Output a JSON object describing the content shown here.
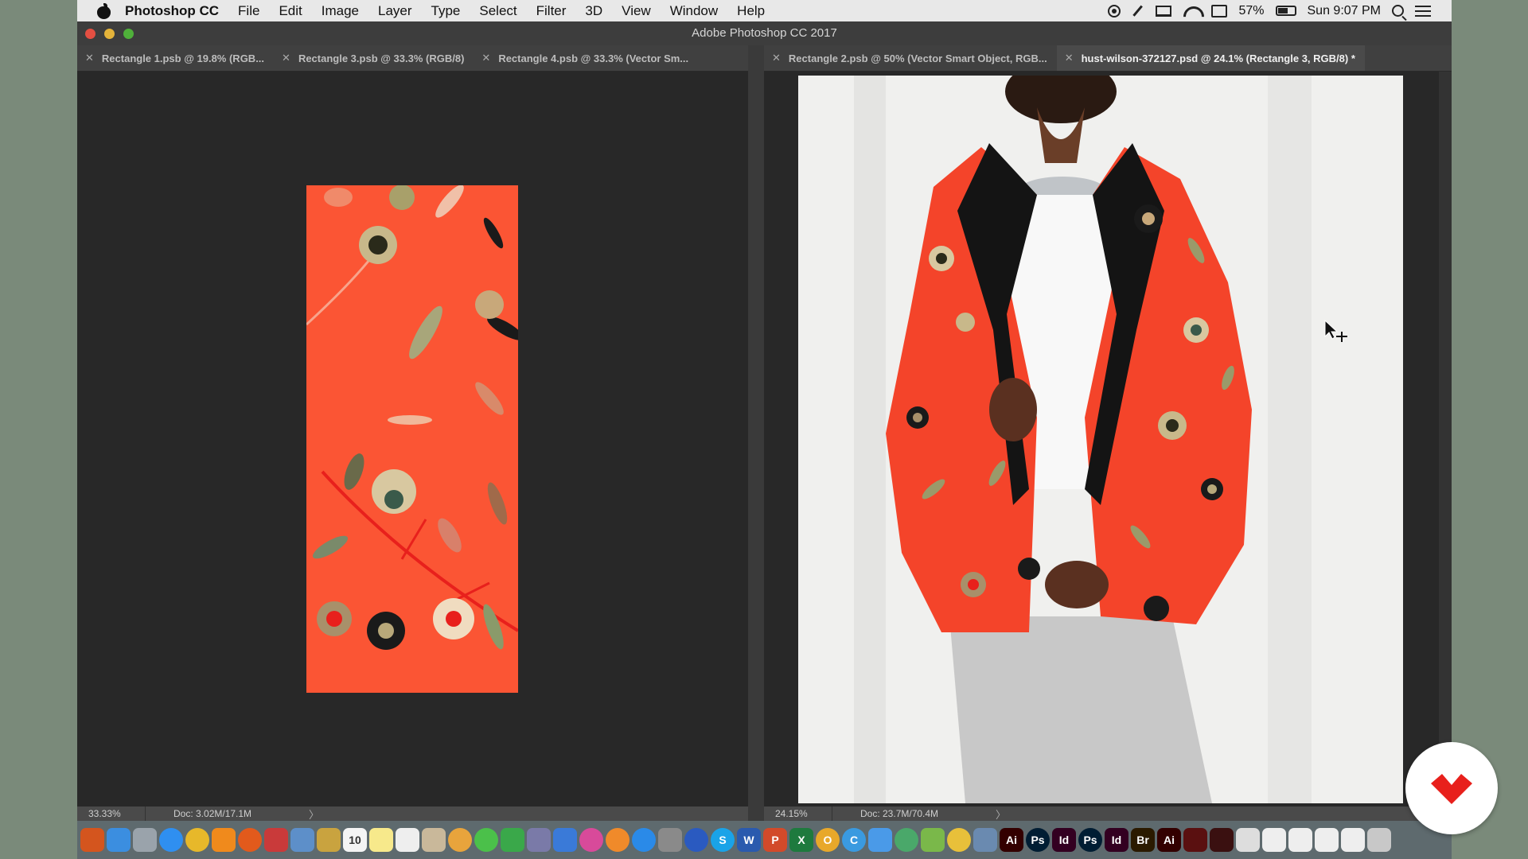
{
  "menubar": {
    "app_name": "Photoshop CC",
    "items": [
      "File",
      "Edit",
      "Image",
      "Layer",
      "Type",
      "Select",
      "Filter",
      "3D",
      "View",
      "Window",
      "Help"
    ],
    "battery": "57%",
    "clock": "Sun 9:07 PM"
  },
  "window": {
    "title": "Adobe Photoshop CC 2017"
  },
  "tabs_left": [
    {
      "label": "Rectangle 1.psb @ 19.8% (RGB..."
    },
    {
      "label": "Rectangle 3.psb @ 33.3% (RGB/8)"
    },
    {
      "label": "Rectangle 4.psb @ 33.3% (Vector Sm..."
    }
  ],
  "tabs_right": [
    {
      "label": "Rectangle 2.psb @ 50% (Vector Smart Object, RGB..."
    },
    {
      "label": "hust-wilson-372127.psd @ 24.1% (Rectangle 3, RGB/8) *"
    }
  ],
  "status_left": {
    "zoom": "33.33%",
    "doc": "Doc: 3.02M/17.1M",
    "arrow": "〉"
  },
  "status_right": {
    "zoom": "24.15%",
    "doc": "Doc: 23.7M/70.4M",
    "arrow": "〉"
  },
  "colors": {
    "pattern": "#fb5534",
    "canvas": "#282828",
    "accent_red": "#e8201c"
  },
  "dock": [
    {
      "icon": "sun-icon",
      "color": "#d4551e",
      "text": ""
    },
    {
      "icon": "finder-icon",
      "color": "#3b8ee0",
      "text": ""
    },
    {
      "icon": "launchpad-icon",
      "color": "#9aa3ab",
      "text": ""
    },
    {
      "icon": "safari-icon",
      "color": "#2f8ff0",
      "text": ""
    },
    {
      "icon": "chrome-icon",
      "color": "#e7b82a",
      "text": ""
    },
    {
      "icon": "vlc-icon",
      "color": "#f08a1c",
      "text": ""
    },
    {
      "icon": "firefox-icon",
      "color": "#e25a1c",
      "text": ""
    },
    {
      "icon": "popcorn-icon",
      "color": "#c93a3a",
      "text": ""
    },
    {
      "icon": "preview-icon",
      "color": "#5d8fc9",
      "text": ""
    },
    {
      "icon": "notes-icon",
      "color": "#c9a33f",
      "text": ""
    },
    {
      "icon": "calendar-icon",
      "color": "#f4f4f4",
      "text": "10"
    },
    {
      "icon": "stickies-icon",
      "color": "#f7e98b",
      "text": ""
    },
    {
      "icon": "textedit-icon",
      "color": "#eeeeee",
      "text": ""
    },
    {
      "icon": "contacts-icon",
      "color": "#c9b89a",
      "text": ""
    },
    {
      "icon": "photos-icon",
      "color": "#e8a43c",
      "text": ""
    },
    {
      "icon": "messages-icon",
      "color": "#4bc04a",
      "text": ""
    },
    {
      "icon": "facetime-icon",
      "color": "#3aa84a",
      "text": ""
    },
    {
      "icon": "pen-icon",
      "color": "#7a7aa8",
      "text": ""
    },
    {
      "icon": "keynote-icon",
      "color": "#3a7ad8",
      "text": ""
    },
    {
      "icon": "itunes-icon",
      "color": "#d84a9a",
      "text": ""
    },
    {
      "icon": "ibooks-icon",
      "color": "#f08a2a",
      "text": ""
    },
    {
      "icon": "appstore-icon",
      "color": "#2a8ae8",
      "text": ""
    },
    {
      "icon": "settings-icon",
      "color": "#8a8a8a",
      "text": ""
    },
    {
      "icon": "quicktime-icon",
      "color": "#2a5ac0",
      "text": ""
    },
    {
      "icon": "skype-icon",
      "color": "#1aa3e8",
      "text": "S"
    },
    {
      "icon": "word-icon",
      "color": "#2a5aae",
      "text": "W"
    },
    {
      "icon": "powerpoint-icon",
      "color": "#d24a2a",
      "text": "P"
    },
    {
      "icon": "excel-icon",
      "color": "#1e7a3e",
      "text": "X"
    },
    {
      "icon": "outlook-icon",
      "color": "#e8a82a",
      "text": "O"
    },
    {
      "icon": "cleanmymac-icon",
      "color": "#3a9ae0",
      "text": "C"
    },
    {
      "icon": "folder-icon",
      "color": "#4a9ae8",
      "text": ""
    },
    {
      "icon": "globe-icon",
      "color": "#4aa86a",
      "text": ""
    },
    {
      "icon": "map-icon",
      "color": "#7ab84a",
      "text": ""
    },
    {
      "icon": "emoji-icon",
      "color": "#e8c03a",
      "text": ""
    },
    {
      "icon": "archive-icon",
      "color": "#6a8ab0",
      "text": ""
    },
    {
      "icon": "illustrator-icon",
      "color": "#330000",
      "text": "Ai"
    },
    {
      "icon": "photoshop-icon",
      "color": "#001d33",
      "text": "Ps"
    },
    {
      "icon": "indesign-icon",
      "color": "#330021",
      "text": "Id"
    },
    {
      "icon": "photoshop-icon",
      "color": "#001d33",
      "text": "Ps"
    },
    {
      "icon": "indesign-icon",
      "color": "#330021",
      "text": "Id"
    },
    {
      "icon": "bridge-icon",
      "color": "#2b1a00",
      "text": "Br"
    },
    {
      "icon": "illustrator-icon",
      "color": "#330000",
      "text": "Ai"
    },
    {
      "icon": "acrobat-icon",
      "color": "#5a1010",
      "text": ""
    },
    {
      "icon": "acrobat-icon",
      "color": "#3a1010",
      "text": ""
    },
    {
      "icon": "document-icon",
      "color": "#dddddd",
      "text": ""
    },
    {
      "icon": "document-icon",
      "color": "#eeeeee",
      "text": ""
    },
    {
      "icon": "document-icon",
      "color": "#eeeeee",
      "text": ""
    },
    {
      "icon": "document-icon",
      "color": "#eeeeee",
      "text": ""
    },
    {
      "icon": "document-icon",
      "color": "#eeeeee",
      "text": ""
    },
    {
      "icon": "trash-icon",
      "color": "#c8c8c8",
      "text": ""
    }
  ]
}
